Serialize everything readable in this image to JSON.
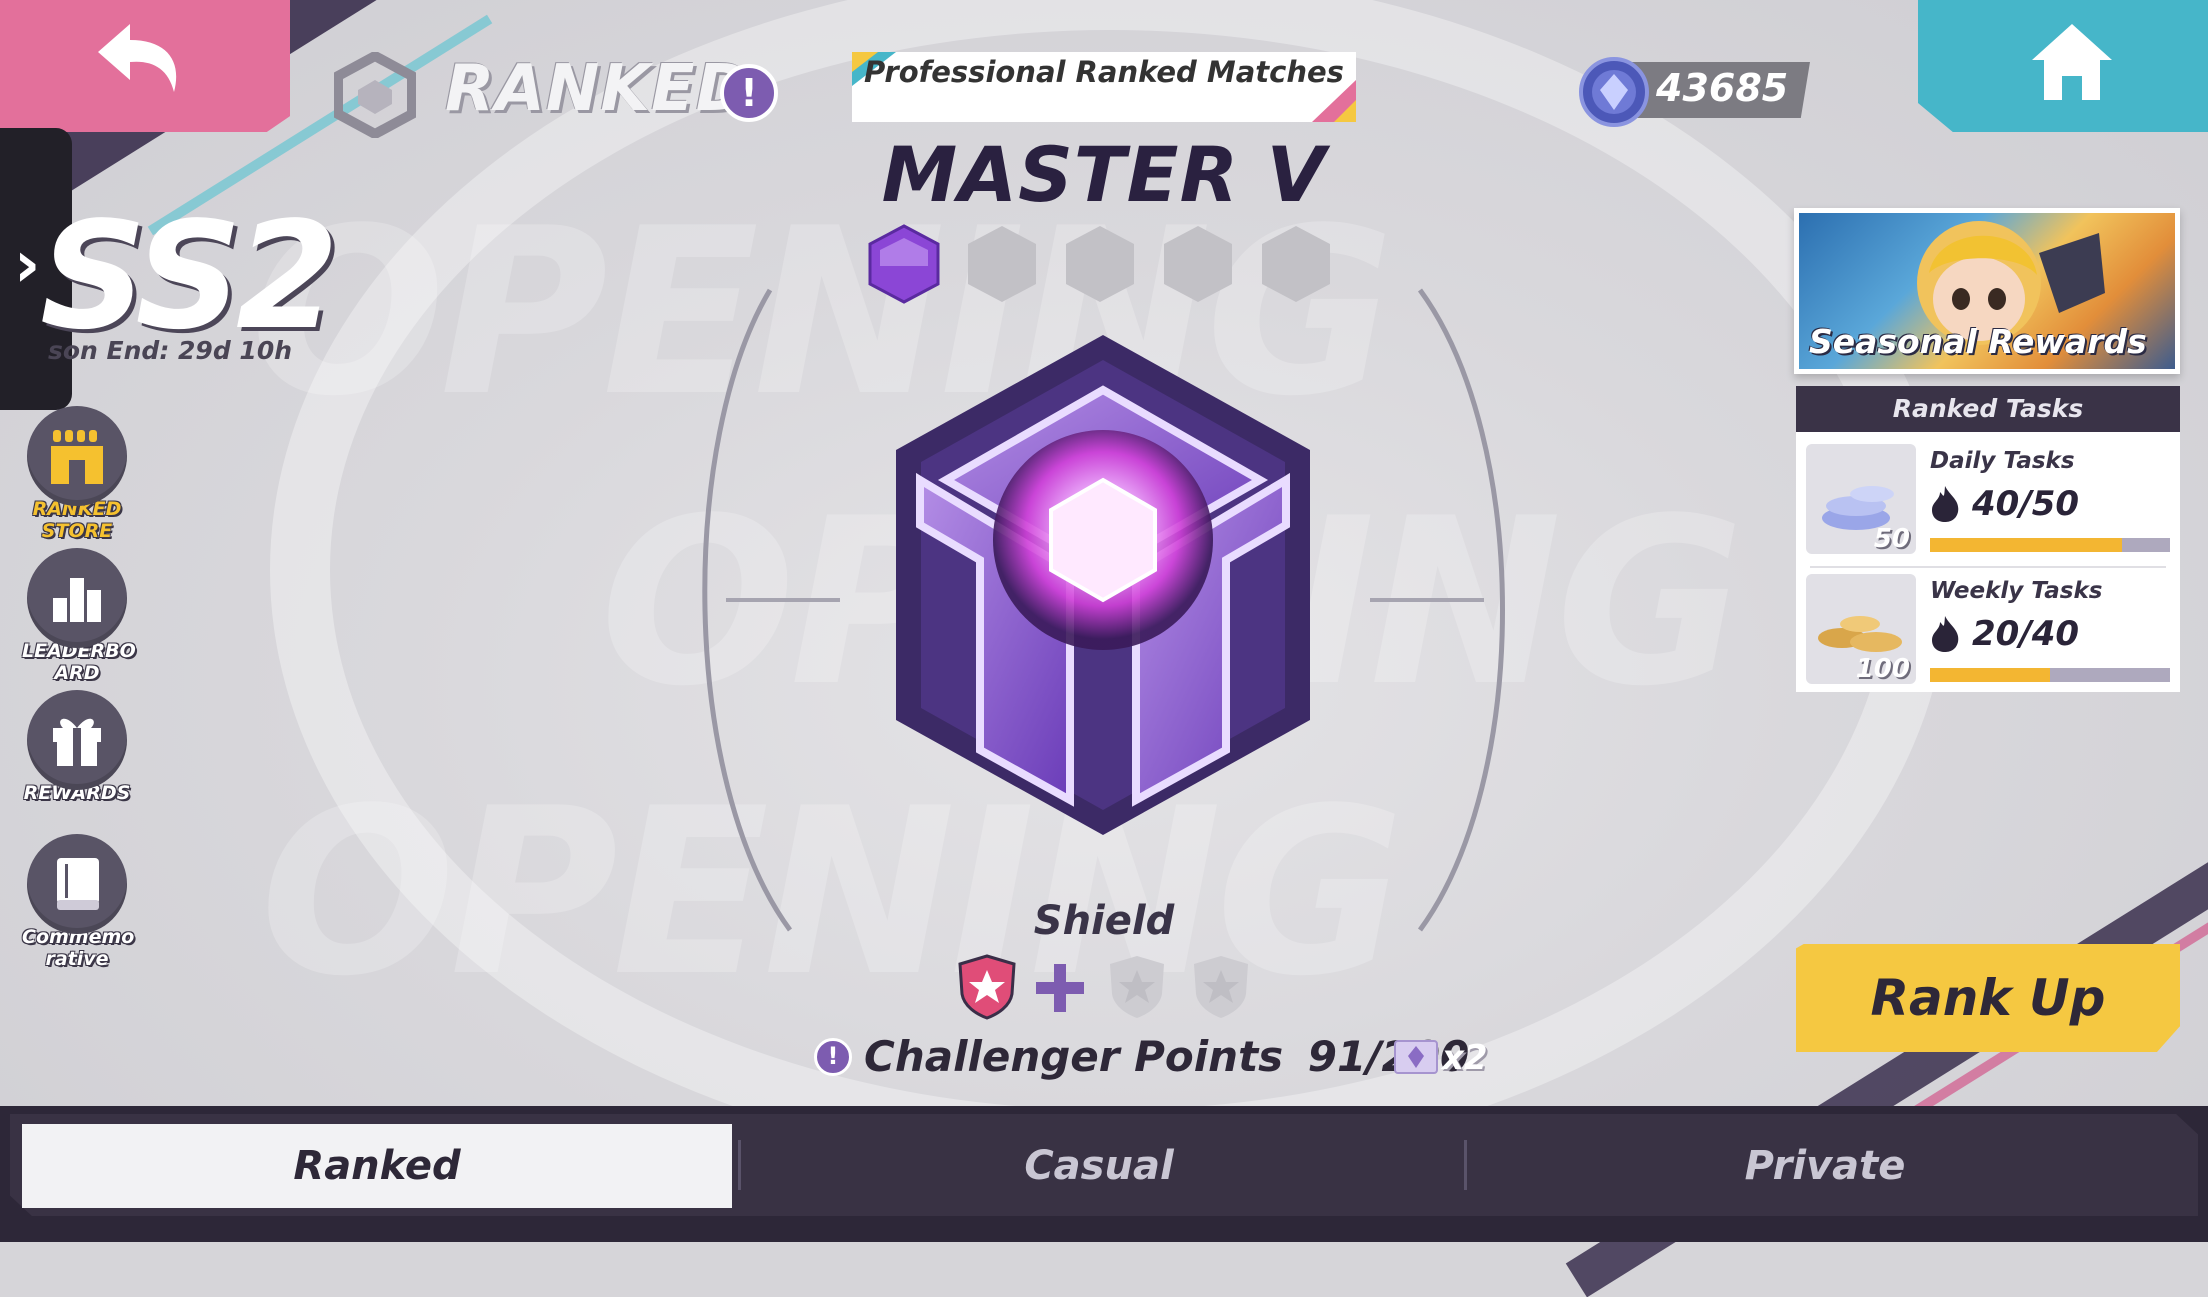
{
  "header": {
    "mode_title": "RANKED",
    "banner": "Professional Ranked Matches",
    "currency_value": "43685"
  },
  "season": {
    "name": "SS2",
    "end_text": "son End: 29d 10h"
  },
  "rank": {
    "title": "MASTER V",
    "pips_filled": 1,
    "pips_total": 5,
    "shield_label": "Shield",
    "challenger_label": "Challenger Points",
    "challenger_value": "91/200",
    "multiplier": "x2"
  },
  "sidebar": {
    "items": [
      {
        "label1": "RANKED",
        "label2": "STORE"
      },
      {
        "label1": "LEADERBO",
        "label2": "ARD"
      },
      {
        "label1": "REWARDS",
        "label2": ""
      },
      {
        "label1": "Commemo",
        "label2": "rative"
      }
    ]
  },
  "rewards": {
    "seasonal_label": "Seasonal Rewards",
    "tasks_title": "Ranked Tasks",
    "tasks": [
      {
        "name": "Daily Tasks",
        "value": "40/50",
        "qty": "50",
        "progress": 0.8
      },
      {
        "name": "Weekly Tasks",
        "value": "20/40",
        "qty": "100",
        "progress": 0.5
      }
    ]
  },
  "actions": {
    "rank_up": "Rank Up"
  },
  "tabs": [
    {
      "label": "Ranked",
      "active": true
    },
    {
      "label": "Casual",
      "active": false
    },
    {
      "label": "Private",
      "active": false
    }
  ],
  "colors": {
    "accent_purple": "#7d5cb0",
    "back_pink": "#e3709b",
    "home_teal": "#46b6c9",
    "rankup_yellow": "#f5c841",
    "progress_orange": "#f3b632",
    "dark_bar": "#2d2738"
  }
}
